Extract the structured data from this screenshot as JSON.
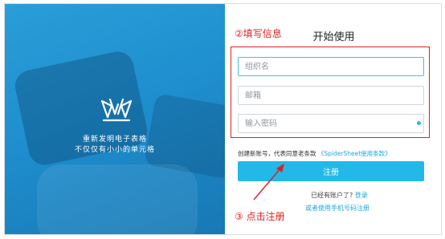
{
  "hero": {
    "line1": "重新发明电子表格",
    "line2": "不仅仅有小小的单元格"
  },
  "form": {
    "title": "开始使用",
    "org_placeholder": "组织名",
    "email_placeholder": "邮箱",
    "password_placeholder": "输入密码",
    "terms_prefix": "创建新账号，代表同意老条款",
    "terms_link": "《SpiderSheet使用条款》",
    "register_label": "注册",
    "have_account_text": "已经有账户了?",
    "login_link": "登录",
    "phone_register_link": "或者使用手机号码注册"
  },
  "annotations": {
    "step2": "②填写信息",
    "step3": "③ 点击注册",
    "color": "#e02020"
  },
  "colors": {
    "accent": "#22b8e8",
    "hero_bg": "#1f8fcf"
  }
}
